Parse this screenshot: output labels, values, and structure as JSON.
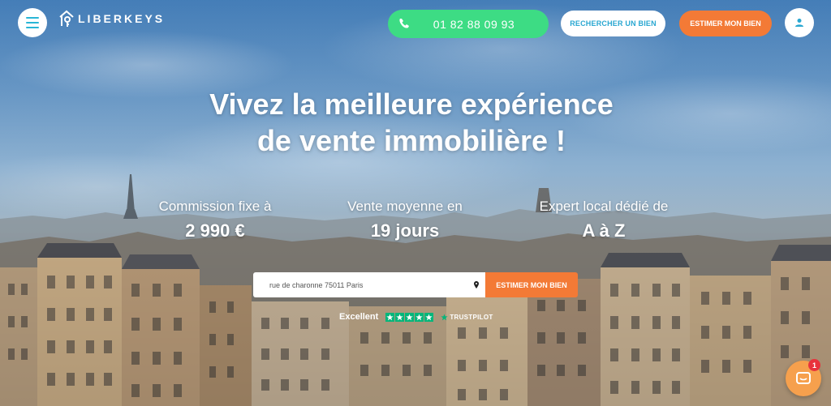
{
  "header": {
    "brand": "LIBERKEYS",
    "phone_number": "01 82 88 09 93",
    "search_button": "RECHERCHER UN BIEN",
    "estimate_button": "ESTIMER MON BIEN"
  },
  "hero": {
    "headline_line1": "Vivez la meilleure expérience",
    "headline_line2": "de vente immobilière !"
  },
  "stats": [
    {
      "label": "Commission fixe à",
      "value": "2 990 €"
    },
    {
      "label": "Vente moyenne en",
      "value": "19 jours"
    },
    {
      "label": "Expert local dédié de",
      "value": "A à Z"
    }
  ],
  "address_search": {
    "value": "rue de charonne 75011 Paris",
    "submit_label": "ESTIMER MON BIEN"
  },
  "trustpilot": {
    "rating_label": "Excellent",
    "stars": 5,
    "brand": "TRUSTPILOT"
  },
  "chat": {
    "badge_count": "1"
  },
  "colors": {
    "accent_orange": "#f37a36",
    "phone_green": "#3ddc84",
    "brand_blue": "#29a7d1",
    "trustpilot_green": "#00b67a"
  }
}
